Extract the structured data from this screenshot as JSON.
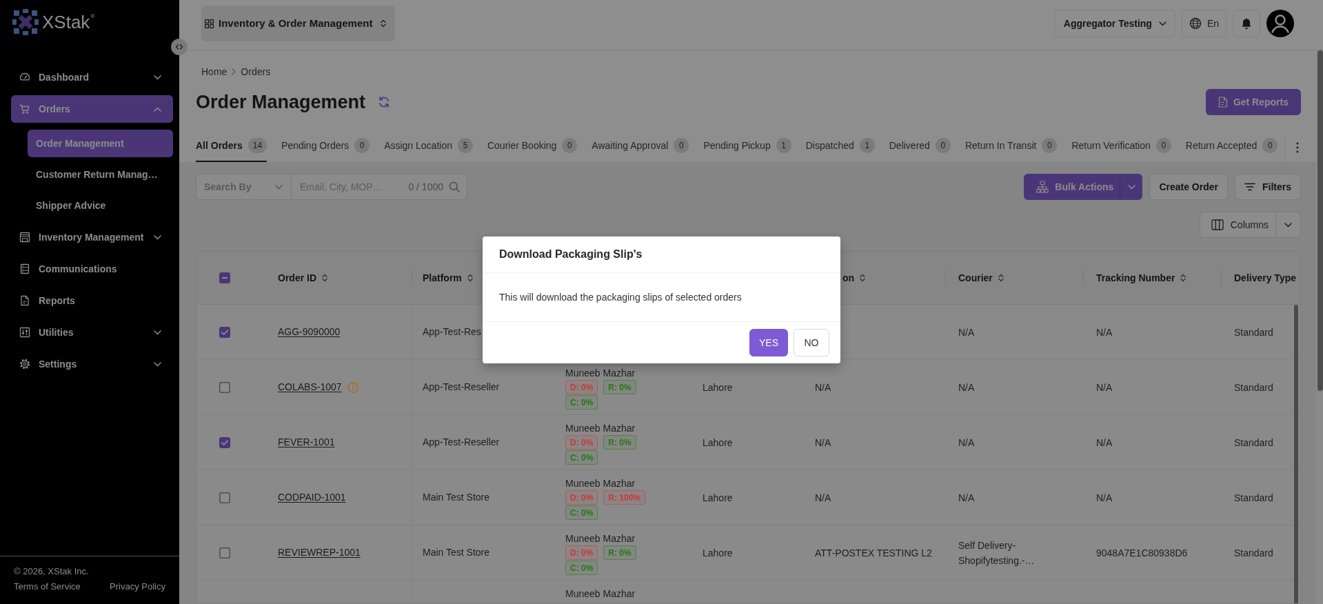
{
  "sidebar": {
    "logo": {
      "name": "XStak",
      "mark": "®"
    },
    "items": [
      {
        "label": "Dashboard",
        "kind": "group",
        "expanded": false,
        "selected": false
      },
      {
        "label": "Orders",
        "kind": "group",
        "expanded": true,
        "selected": true,
        "children": [
          {
            "label": "Order Management",
            "selected": true
          },
          {
            "label": "Customer Return Manag…",
            "selected": false
          },
          {
            "label": "Shipper Advice",
            "selected": false
          }
        ]
      },
      {
        "label": "Inventory Management",
        "kind": "group",
        "expanded": false,
        "selected": false
      },
      {
        "label": "Communications",
        "kind": "link",
        "selected": false
      },
      {
        "label": "Reports",
        "kind": "link",
        "selected": false
      },
      {
        "label": "Utilities",
        "kind": "group",
        "expanded": false,
        "selected": false
      },
      {
        "label": "Settings",
        "kind": "group",
        "expanded": false,
        "selected": false
      }
    ],
    "footer": {
      "copyright": "© 2026, XStak Inc.",
      "links": [
        "Terms of Service",
        "Privacy Policy"
      ]
    }
  },
  "top_bar": {
    "module_switcher": "Inventory & Order Management",
    "account_menu": "Aggregator Testing",
    "language": "En"
  },
  "breadcrumb": [
    "Home",
    "Orders"
  ],
  "page_header": {
    "title": "Order Management",
    "get_reports_button": "Get Reports"
  },
  "tabs": [
    {
      "label": "All Orders",
      "count": "14",
      "selected": true
    },
    {
      "label": "Pending Orders",
      "count": "0",
      "selected": false
    },
    {
      "label": "Assign Location",
      "count": "5",
      "selected": false
    },
    {
      "label": "Courier Booking",
      "count": "0",
      "selected": false
    },
    {
      "label": "Awaiting Approval",
      "count": "0",
      "selected": false
    },
    {
      "label": "Pending Pickup",
      "count": "1",
      "selected": false
    },
    {
      "label": "Dispatched",
      "count": "1",
      "selected": false
    },
    {
      "label": "Delivered",
      "count": "0",
      "selected": false
    },
    {
      "label": "Return In Transit",
      "count": "0",
      "selected": false
    },
    {
      "label": "Return Verification",
      "count": "0",
      "selected": false
    },
    {
      "label": "Return Accepted",
      "count": "0",
      "selected": false
    }
  ],
  "toolbar": {
    "search_by": {
      "placeholder": "Search By"
    },
    "search": {
      "placeholder": "Email, City, MOP…",
      "counter": "0 / 1000"
    },
    "bulk_actions_button": "Bulk Actions",
    "create_order_button": "Create Order",
    "filters_button": "Filters",
    "columns_button": "Columns"
  },
  "table": {
    "select_all": {
      "indeterminate": true
    },
    "columns": [
      {
        "label": "Order ID",
        "sortable": true
      },
      {
        "label": "Platform",
        "sortable": true
      },
      {
        "label": "on",
        "sortable": true
      },
      {
        "label": "Courier",
        "sortable": true
      },
      {
        "label": "Tracking Number",
        "sortable": true
      },
      {
        "label": "Delivery Type",
        "sortable": false
      }
    ],
    "rows": [
      {
        "selected": true,
        "order_id": "AGG-9090000",
        "alert": false,
        "platform": "App-Test-Res",
        "courier": "N/A",
        "tracking_number": "N/A",
        "delivery_type": "Standard"
      },
      {
        "selected": false,
        "order_id": "COLABS-1007",
        "alert": true,
        "platform": "App-Test-Reseller",
        "customer": {
          "name": "Muneeb Mazhar",
          "tags": [
            {
              "label": "D: 0%",
              "color": "#c43a3a"
            },
            {
              "label": "R: 0%",
              "color": "#2a7416"
            },
            {
              "label": "C: 0%",
              "color": "#2a7416"
            }
          ]
        },
        "city": "Lahore",
        "location": "N/A",
        "courier": "N/A",
        "tracking_number": "N/A",
        "delivery_type": "Standard"
      },
      {
        "selected": true,
        "order_id": "FEVER-1001",
        "alert": false,
        "platform": "App-Test-Reseller",
        "customer": {
          "name": "Muneeb Mazhar",
          "tags": [
            {
              "label": "D: 0%",
              "color": "#c43a3a"
            },
            {
              "label": "R: 0%",
              "color": "#2a7416"
            },
            {
              "label": "C: 0%",
              "color": "#2a7416"
            }
          ]
        },
        "city": "Lahore",
        "location": "N/A",
        "courier": "N/A",
        "tracking_number": "N/A",
        "delivery_type": "Standard"
      },
      {
        "selected": false,
        "order_id": "CODPAID-1001",
        "alert": false,
        "platform": "Main Test Store",
        "customer": {
          "name": "Muneeb Mazhar",
          "tags": [
            {
              "label": "D: 0%",
              "color": "#c43a3a"
            },
            {
              "label": "R: 100%",
              "color": "#c43a3a"
            },
            {
              "label": "C: 0%",
              "color": "#2a7416"
            }
          ]
        },
        "city": "Lahore",
        "location": "N/A",
        "courier": "N/A",
        "tracking_number": "N/A",
        "delivery_type": "Standard"
      },
      {
        "selected": false,
        "order_id": "REVIEWREP-1001",
        "alert": false,
        "platform": "Main Test Store",
        "customer": {
          "name": "Muneeb Mazhar",
          "tags": [
            {
              "label": "D: 0%",
              "color": "#c43a3a"
            },
            {
              "label": "R: 0%",
              "color": "#2a7416"
            },
            {
              "label": "C: 0%",
              "color": "#2a7416"
            }
          ]
        },
        "city": "Lahore",
        "location": "ATT-POSTEX TESTING L2",
        "courier": "Self Delivery-Shopifytesting.-…",
        "tracking_number": "9048A7E1C80938D6",
        "delivery_type": "Standard"
      },
      {
        "customer": {
          "name": "Muneeb Mazhar"
        }
      }
    ]
  },
  "dialog": {
    "title": "Download Packaging Slip's",
    "message": "This will download the packaging slips of selected orders",
    "buttons": [
      {
        "label": "YES",
        "kind": "primary"
      },
      {
        "label": "NO",
        "kind": "default"
      }
    ]
  }
}
